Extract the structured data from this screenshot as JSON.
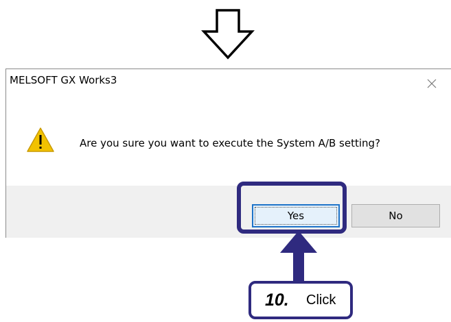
{
  "flow_indicator": {
    "icon": "down-arrow-icon"
  },
  "dialog": {
    "title": "MELSOFT GX Works3",
    "close_icon": "close-icon",
    "warning_icon": "warning-icon",
    "message": "Are you sure you want to execute the System A/B setting?",
    "buttons": {
      "yes_label": "Yes",
      "no_label": "No"
    }
  },
  "annotation": {
    "step_number": "10.",
    "action": "Click",
    "highlight_color": "#2f2a7f",
    "pointer_icon": "up-arrow-icon"
  },
  "colors": {
    "dialog_footer": "#f0f0f0",
    "button_face": "#e1e1e1",
    "default_button_border": "#1d73c8",
    "warning_yellow": "#f2c200"
  }
}
